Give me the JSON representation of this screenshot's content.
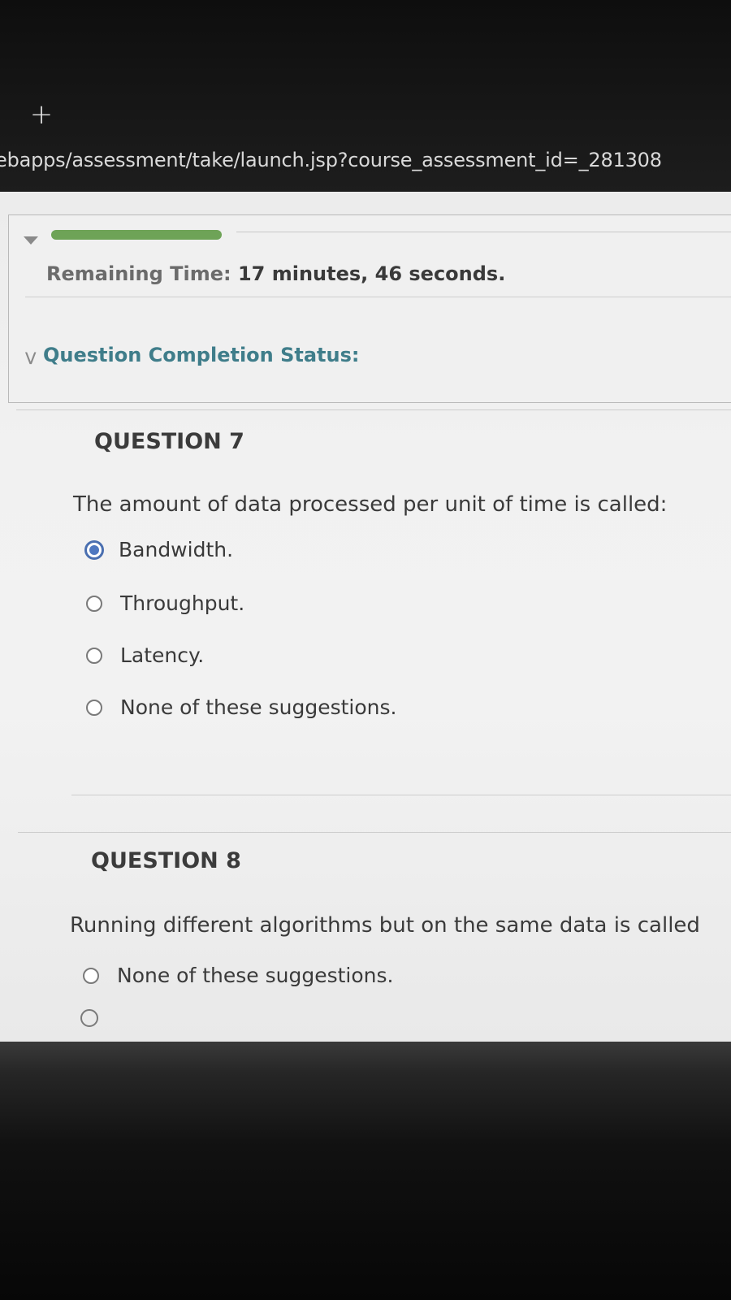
{
  "browser": {
    "new_tab_icon": "plus-icon",
    "url": "ebapps/assessment/take/launch.jsp?course_assessment_id=_281308"
  },
  "status": {
    "progress_fraction": 0.25,
    "progress_color": "#6ea357",
    "remaining_label": "Remaining Time:",
    "remaining_value": "17 minutes, 46 seconds.",
    "completion_label": "Question Completion Status:"
  },
  "questions": [
    {
      "title": "QUESTION 7",
      "text": "The amount of data processed per unit of time  is called:",
      "options": [
        {
          "label": "Bandwidth.",
          "selected": true
        },
        {
          "label": "Throughput.",
          "selected": false
        },
        {
          "label": "Latency.",
          "selected": false
        },
        {
          "label": "None of these suggestions.",
          "selected": false
        }
      ]
    },
    {
      "title": "QUESTION 8",
      "text": "Running different algorithms but on the same data  is called",
      "options": [
        {
          "label": "None of these suggestions.",
          "selected": false
        }
      ]
    }
  ],
  "colors": {
    "accent_teal": "#3f7d8a",
    "radio_selected": "#4f78c0"
  }
}
